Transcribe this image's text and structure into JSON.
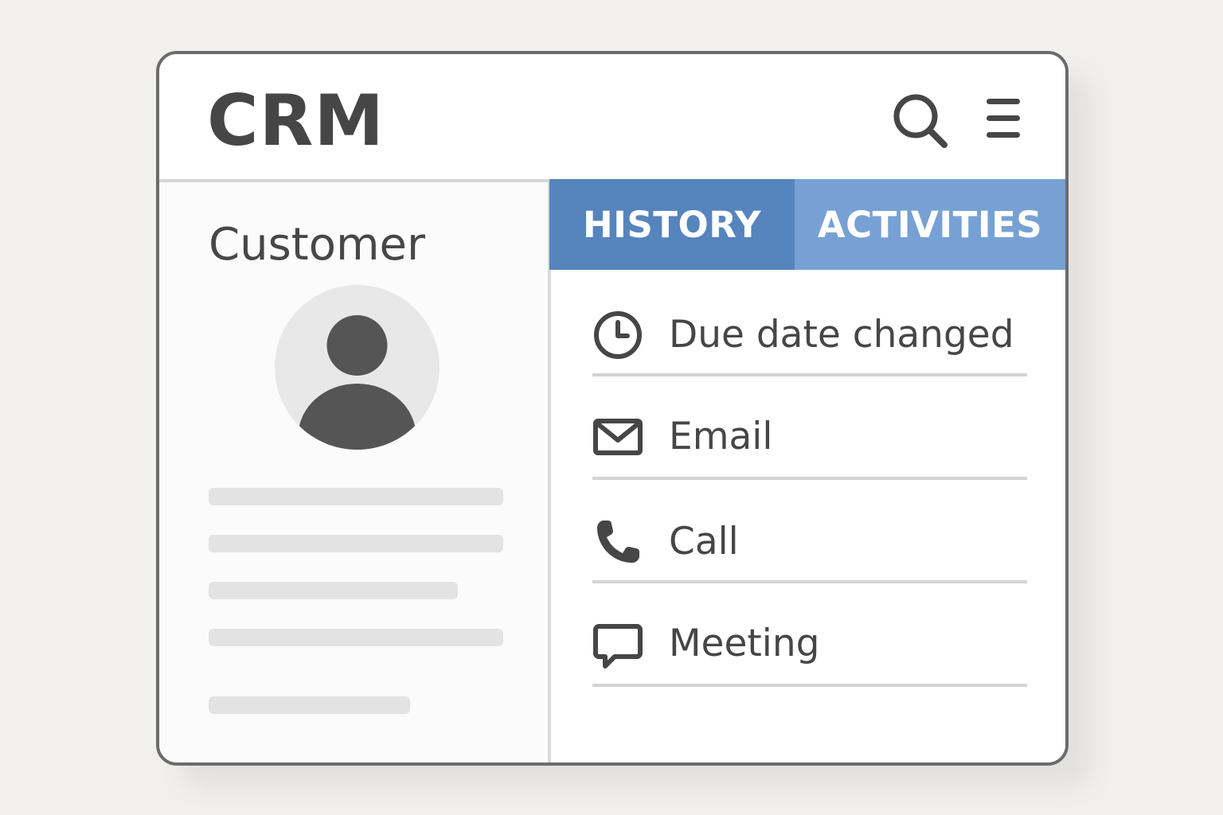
{
  "app": {
    "title": "CRM"
  },
  "header": {
    "icons": [
      "search-icon",
      "menu-icon"
    ]
  },
  "customer_panel": {
    "title": "Customer",
    "avatar_icon": "user-avatar-icon"
  },
  "tabs": [
    {
      "label": "HISTORY",
      "color": "#5684bd"
    },
    {
      "label": "ACTIVITIES",
      "color": "#77a1d4"
    }
  ],
  "activities": [
    {
      "label": "Due date changed",
      "icon": "clock-icon"
    },
    {
      "label": "Email",
      "icon": "envelope-icon"
    },
    {
      "label": "Call",
      "icon": "phone-icon"
    },
    {
      "label": "Meeting",
      "icon": "chat-bubble-icon"
    }
  ],
  "colors": {
    "background": "#f1f0ee",
    "window_border": "#6b6b6b",
    "text": "#464646",
    "tab_history": "#5684bd",
    "tab_activities": "#77a1d4"
  }
}
